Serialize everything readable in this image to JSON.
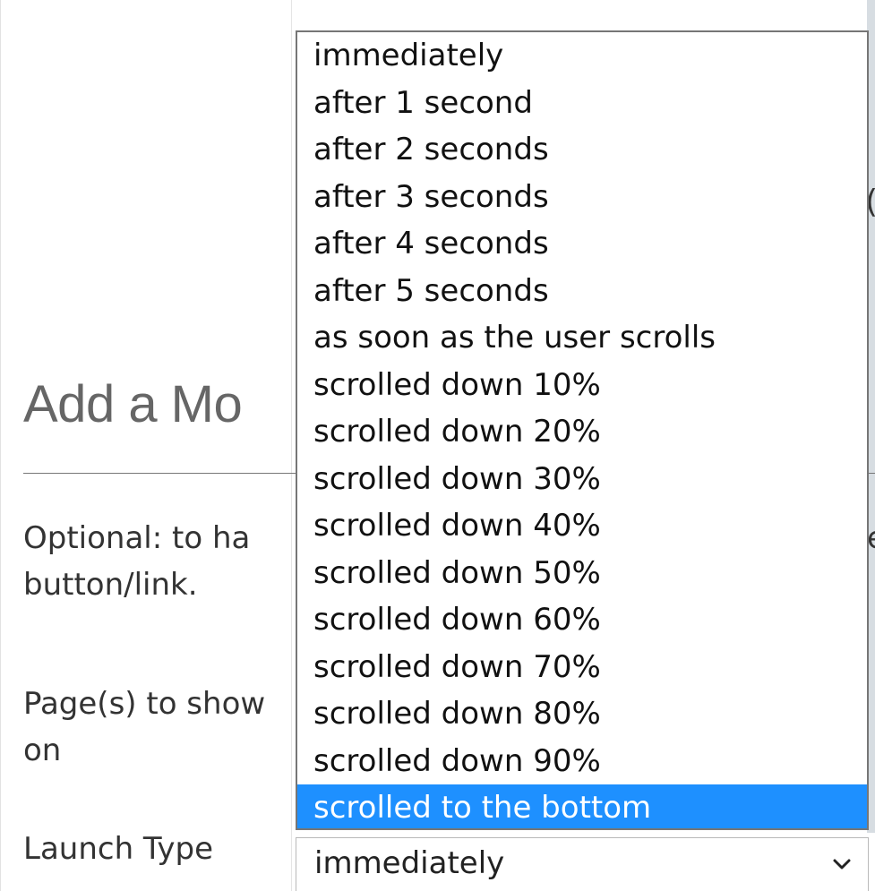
{
  "form": {
    "section_title": "Add a Mo",
    "optional_text": "Optional: to ha",
    "optional_text_line2": "button/link.",
    "optional_text_trailing": "e",
    "pages_label": "Page(s) to show on",
    "launch_type_label": "Launch Type",
    "partial_char": "("
  },
  "launch_select": {
    "value": "immediately",
    "icon": "chevron-down-icon",
    "options": [
      "immediately",
      "after 1 second",
      "after 2 seconds",
      "after 3 seconds",
      "after 4 seconds",
      "after 5 seconds",
      "as soon as the user scrolls",
      "scrolled down 10%",
      "scrolled down 20%",
      "scrolled down 30%",
      "scrolled down 40%",
      "scrolled down 50%",
      "scrolled down 60%",
      "scrolled down 70%",
      "scrolled down 80%",
      "scrolled down 90%",
      "scrolled to the bottom"
    ],
    "highlighted": "scrolled to the bottom"
  },
  "colors": {
    "highlight": "#1e90ff",
    "highlight_text": "#ffffff"
  }
}
